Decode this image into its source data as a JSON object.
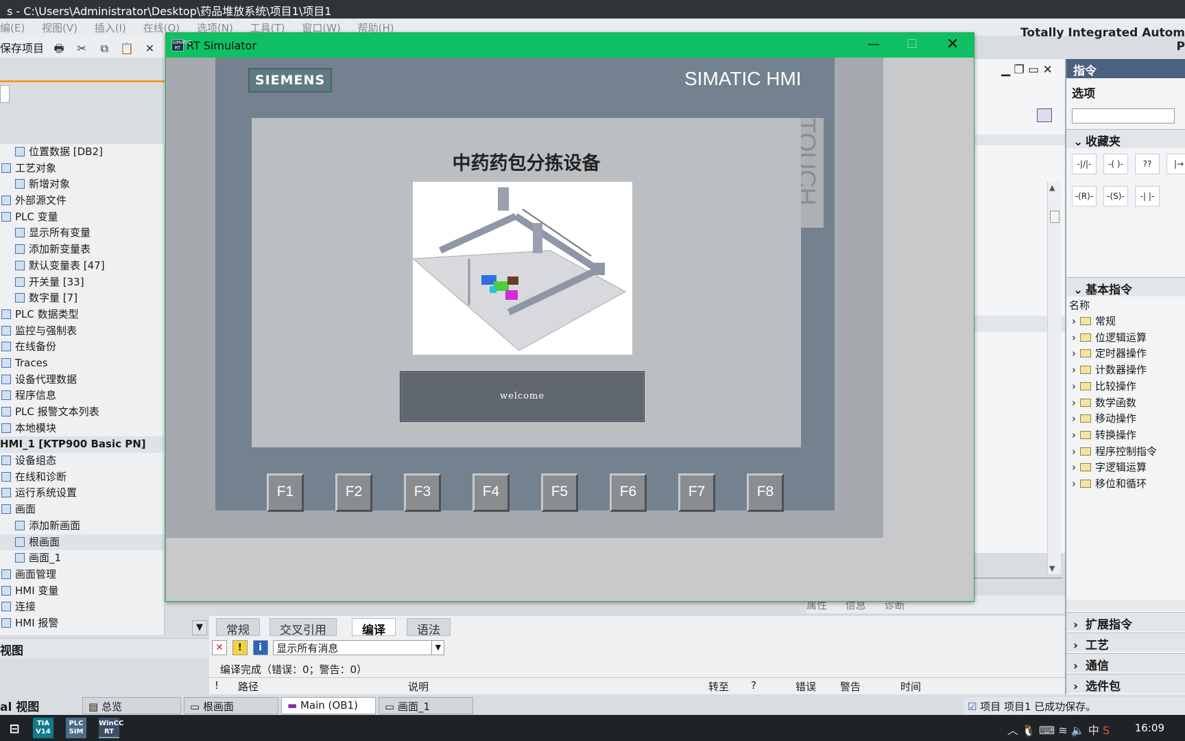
{
  "app": {
    "title_path": "s - C:\\Users\\Administrator\\Desktop\\药品堆放系统\\项目1\\项目1",
    "brand": "Totally Integrated Autom",
    "brand_line2": "P"
  },
  "menu": [
    "编(E)",
    "视图(V)",
    "插入(I)",
    "在线(O)",
    "选项(N)",
    "工具(T)",
    "窗口(W)",
    "帮助(H)"
  ],
  "toolbar": {
    "save_label": "保存项目"
  },
  "tree": {
    "items": [
      {
        "label": "位置数据 [DB2]",
        "indent": 2
      },
      {
        "label": "工艺对象",
        "indent": 1
      },
      {
        "label": "新增对象",
        "indent": 2
      },
      {
        "label": "外部源文件",
        "indent": 1
      },
      {
        "label": "PLC 变量",
        "indent": 1
      },
      {
        "label": "显示所有变量",
        "indent": 2
      },
      {
        "label": "添加新变量表",
        "indent": 2
      },
      {
        "label": "默认变量表 [47]",
        "indent": 2
      },
      {
        "label": "开关量 [33]",
        "indent": 2
      },
      {
        "label": "数字量 [7]",
        "indent": 2
      },
      {
        "label": "PLC 数据类型",
        "indent": 1
      },
      {
        "label": "监控与强制表",
        "indent": 1
      },
      {
        "label": "在线备份",
        "indent": 1
      },
      {
        "label": "Traces",
        "indent": 1
      },
      {
        "label": "设备代理数据",
        "indent": 1
      },
      {
        "label": "程序信息",
        "indent": 1
      },
      {
        "label": "PLC 报警文本列表",
        "indent": 1
      },
      {
        "label": "本地模块",
        "indent": 1
      },
      {
        "label": "HMI_1 [KTP900 Basic PN]",
        "indent": 0
      },
      {
        "label": "设备组态",
        "indent": 1
      },
      {
        "label": "在线和诊断",
        "indent": 1
      },
      {
        "label": "运行系统设置",
        "indent": 1
      },
      {
        "label": "画面",
        "indent": 1
      },
      {
        "label": "添加新画面",
        "indent": 2
      },
      {
        "label": "根画面",
        "indent": 2
      },
      {
        "label": "画面_1",
        "indent": 2
      },
      {
        "label": "画面管理",
        "indent": 1
      },
      {
        "label": "HMI 变量",
        "indent": 1
      },
      {
        "label": "连接",
        "indent": 1
      },
      {
        "label": "HMI 报警",
        "indent": 1
      }
    ],
    "detail_title": "视图"
  },
  "simulator": {
    "title": "RT Simulator",
    "logo_text": "SIMATIC RT",
    "brand_left": "SIEMENS",
    "brand_right": "SIMATIC HMI",
    "touch_label": "TOUCH",
    "screen_title": "中药药包分拣设备",
    "welcome_button": "welcome",
    "fkeys": [
      "F1",
      "F2",
      "F3",
      "F4",
      "F5",
      "F6",
      "F7",
      "F8"
    ]
  },
  "inspector": {
    "status_tabs": [
      "属性",
      "信息",
      "诊断"
    ]
  },
  "bottom": {
    "tabs": [
      "常规",
      "交叉引用",
      "编译",
      "语法"
    ],
    "active_tab": "编译",
    "filter_value": "显示所有消息",
    "compile_message": "编译完成（错误：0；警告：0）",
    "columns": [
      "!",
      "路径",
      "说明",
      "转至",
      "?",
      "错误",
      "警告",
      "时间"
    ]
  },
  "right_panel": {
    "title": "指令",
    "options_label": "选项",
    "favorites_label": "收藏夹",
    "favorites": [
      "-|/|-",
      "-( )-",
      "??",
      "|→",
      "-(R)-",
      "-(S)-",
      "-| |-"
    ],
    "basic_label": "基本指令",
    "name_col": "名称",
    "basic_items": [
      "常规",
      "位逻辑运算",
      "定时器操作",
      "计数器操作",
      "比较操作",
      "数学函数",
      "移动操作",
      "转换操作",
      "程序控制指令",
      "字逻辑运算",
      "移位和循环"
    ],
    "ext_label": "扩展指令",
    "tech_label": "工艺",
    "comm_label": "通信",
    "pkg_label": "选件包"
  },
  "portal": {
    "label": "al 视图"
  },
  "doc_tabs": [
    {
      "label": "总览"
    },
    {
      "label": "根画面"
    },
    {
      "label": "Main (OB1)"
    },
    {
      "label": "画面_1"
    }
  ],
  "status": {
    "saved_message": "项目 项目1 已成功保存。"
  },
  "taskbar": {
    "apps": [
      "TIA V14",
      "PLC SIM",
      "WinCC RT"
    ],
    "ime": "中",
    "clock": "16:09"
  }
}
